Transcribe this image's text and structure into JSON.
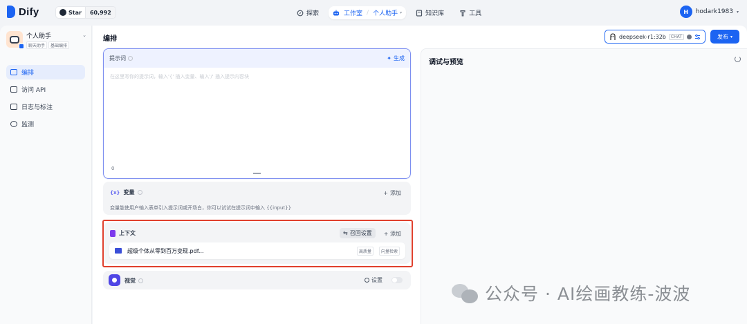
{
  "topbar": {
    "logo_text": "Dify",
    "github": {
      "star_label": "Star",
      "count": "60,992"
    },
    "nav": {
      "explore": "探索",
      "studio": "工作室",
      "current_app": "个人助手",
      "knowledge": "知识库",
      "tools": "工具"
    },
    "user": {
      "initial": "H",
      "name": "hodark1983"
    }
  },
  "sidebar": {
    "app": {
      "name": "个人助手",
      "tags": [
        "聊天助手",
        "基础编排"
      ]
    },
    "items": [
      {
        "label": "编排",
        "active": true
      },
      {
        "label": "访问 API",
        "active": false
      },
      {
        "label": "日志与标注",
        "active": false
      },
      {
        "label": "监测",
        "active": false
      }
    ]
  },
  "main": {
    "title": "编排",
    "model": {
      "name": "deepseek-r1:32b",
      "mode": "CHAT"
    },
    "publish_label": "发布",
    "prompt": {
      "label": "提示词",
      "generate_label": "生成",
      "placeholder": "在这里写你的提示词，输入'{' 插入变量、输入'/' 插入提示内容块",
      "char_count": "0"
    },
    "variables": {
      "title": "变量",
      "add_label": "添加",
      "description": "变量能使用户输入表单引入提示词或开场白，你可以试试在提示词中输入 {{input}}"
    },
    "context": {
      "title": "上下文",
      "recall_label": "召回设置",
      "add_label": "添加",
      "file": {
        "name": "超级个体从零到百万变现.pdf...",
        "tags": [
          "高质量",
          "向量检索"
        ]
      }
    },
    "vision": {
      "title": "视觉",
      "settings_label": "设置"
    },
    "debug": {
      "title": "调试与预览"
    }
  },
  "watermark": {
    "text": "公众号 · AI绘画教练-波波"
  },
  "colors": {
    "accent": "#1c64f2",
    "highlight_border": "#e0402d"
  }
}
